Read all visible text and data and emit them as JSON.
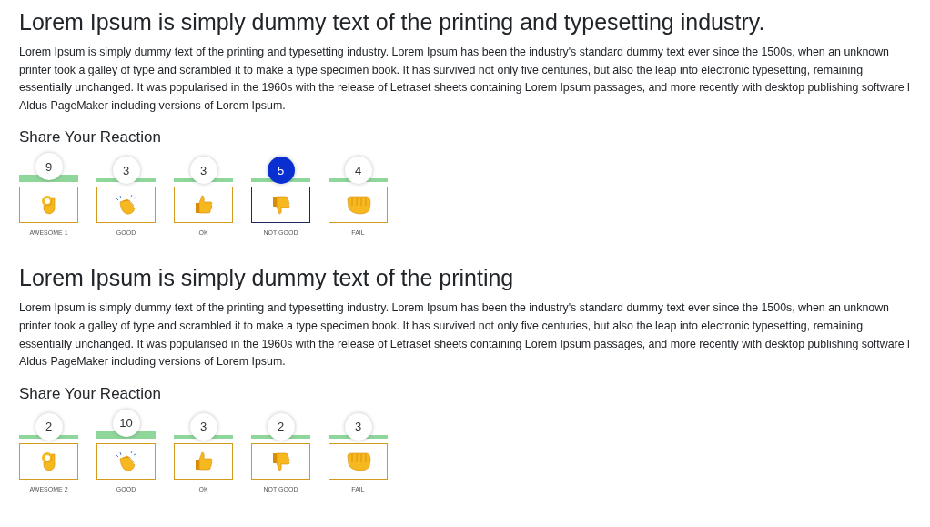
{
  "sections": [
    {
      "title": "Lorem Ipsum is simply dummy text of the printing and typesetting industry.",
      "paragraph_lines": [
        "Lorem Ipsum is simply dummy text of the printing and typesetting industry. Lorem Ipsum has been the industry's standard dummy text ever since the 1500s, when an unknown",
        "printer took a galley of type and scrambled it to make a type specimen book. It has survived not only five centuries, but also the leap into electronic typesetting, remaining",
        "essentially unchanged. It was popularised in the 1960s with the release of Letraset sheets containing Lorem Ipsum passages, and more recently with desktop publishing software l",
        "Aldus PageMaker including versions of Lorem Ipsum."
      ],
      "reaction_heading": "Share Your Reaction",
      "reactions": [
        {
          "kind": "ok",
          "count": "9",
          "label": "AWESOME 1",
          "top": true,
          "selected": false
        },
        {
          "kind": "clap",
          "count": "3",
          "label": "GOOD",
          "top": false,
          "selected": false
        },
        {
          "kind": "thumbs-up",
          "count": "3",
          "label": "OK",
          "top": false,
          "selected": false
        },
        {
          "kind": "thumbs-down",
          "count": "5",
          "label": "NOT GOOD",
          "top": false,
          "selected": true
        },
        {
          "kind": "fist",
          "count": "4",
          "label": "FAIL",
          "top": false,
          "selected": false
        }
      ]
    },
    {
      "title": "Lorem Ipsum is simply dummy text of the printing",
      "paragraph_lines": [
        "Lorem Ipsum is simply dummy text of the printing and typesetting industry. Lorem Ipsum has been the industry's standard dummy text ever since the 1500s, when an unknown",
        "printer took a galley of type and scrambled it to make a type specimen book. It has survived not only five centuries, but also the leap into electronic typesetting, remaining",
        "essentially unchanged. It was popularised in the 1960s with the release of Letraset sheets containing Lorem Ipsum passages, and more recently with desktop publishing software l",
        "Aldus PageMaker including versions of Lorem Ipsum."
      ],
      "reaction_heading": "Share Your Reaction",
      "reactions": [
        {
          "kind": "ok",
          "count": "2",
          "label": "AWESOME 2",
          "top": false,
          "selected": false
        },
        {
          "kind": "clap",
          "count": "10",
          "label": "GOOD",
          "top": true,
          "selected": false
        },
        {
          "kind": "thumbs-up",
          "count": "3",
          "label": "OK",
          "top": false,
          "selected": false
        },
        {
          "kind": "thumbs-down",
          "count": "2",
          "label": "NOT GOOD",
          "top": false,
          "selected": false
        },
        {
          "kind": "fist",
          "count": "3",
          "label": "FAIL",
          "top": false,
          "selected": false
        }
      ]
    }
  ]
}
